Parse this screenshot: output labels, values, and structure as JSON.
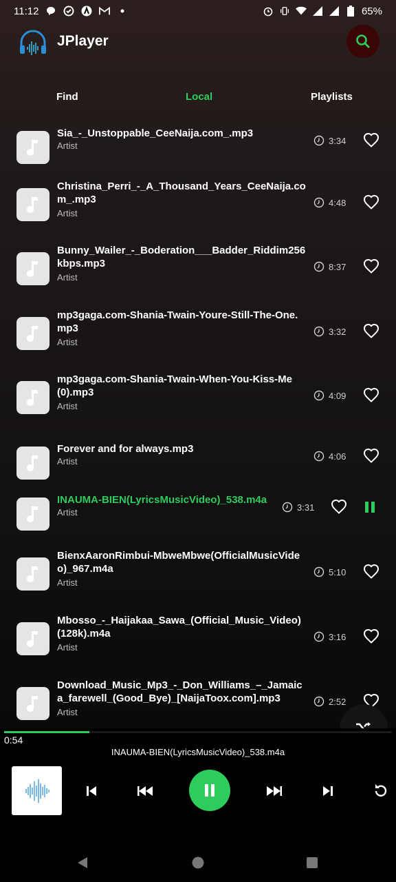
{
  "status": {
    "time": "11:12",
    "battery": "65%",
    "left_icons": [
      "chat-icon",
      "check-circle-icon",
      "a-app-icon",
      "gmail-icon",
      "dot-icon"
    ],
    "right_icons": [
      "alarm-icon",
      "vibrate-icon",
      "wifi-icon",
      "signal-icon",
      "signal-icon",
      "battery-icon"
    ]
  },
  "app": {
    "title": "JPlayer"
  },
  "tabs": [
    {
      "label": "Find",
      "active": false
    },
    {
      "label": "Local",
      "active": true
    },
    {
      "label": "Playlists",
      "active": false
    }
  ],
  "songs": [
    {
      "title": "Sia_-_Unstoppable_CeeNaija.com_.mp3",
      "artist": "Artist",
      "duration": "3:34"
    },
    {
      "title": "Christina_Perri_-_A_Thousand_Years_CeeNaija.com_.mp3",
      "artist": "Artist",
      "duration": "4:48"
    },
    {
      "title": "Bunny_Wailer_-_Boderation___Badder_Riddim256kbps.mp3",
      "artist": "Artist",
      "duration": "8:37"
    },
    {
      "title": "mp3gaga.com-Shania-Twain-Youre-Still-The-One.mp3",
      "artist": "Artist",
      "duration": "3:32"
    },
    {
      "title": "mp3gaga.com-Shania-Twain-When-You-Kiss-Me(0).mp3",
      "artist": "Artist",
      "duration": "4:09"
    },
    {
      "title": "Forever and for always.mp3",
      "artist": "Artist",
      "duration": "4:06"
    },
    {
      "title": "INAUMA-BIEN(LyricsMusicVideo)_538.m4a",
      "artist": "Artist",
      "duration": "3:31",
      "playing": true
    },
    {
      "title": "BienxAaronRimbui-MbweMbwe(OfficialMusicVideo)_967.m4a",
      "artist": "Artist",
      "duration": "5:10"
    },
    {
      "title": "Mbosso_-_Haijakaa_Sawa_(Official_Music_Video)(128k).m4a",
      "artist": "Artist",
      "duration": "3:16"
    },
    {
      "title": "Download_Music_Mp3_-_Don_Williams_–_Jamaica_farewell_(Good_Bye)_[NaijaToox.com].mp3",
      "artist": "Artist",
      "duration": "2:52"
    }
  ],
  "player": {
    "elapsed": "0:54",
    "now_playing": "INAUMA-BIEN(LyricsMusicVideo)_538.m4a",
    "progress_fraction": 0.22
  },
  "colors": {
    "accent": "#2ecc5c",
    "header_bg": "#2a1f1e",
    "thumb_bg": "#e5e5e5"
  }
}
